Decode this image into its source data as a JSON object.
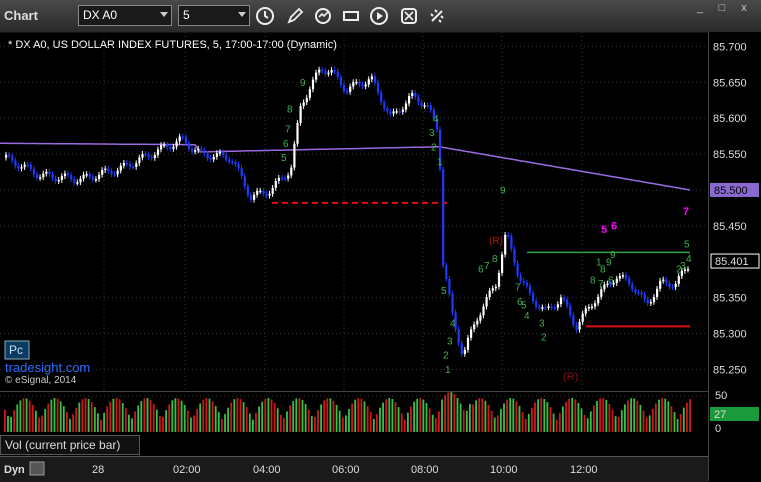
{
  "app": {
    "title": "Chart"
  },
  "toolbar": {
    "symbol": "DX A0",
    "interval": "5",
    "tools": [
      "clock-icon",
      "pencil-icon",
      "refresh-icon",
      "template-icon",
      "play-icon",
      "settings-icon",
      "link-icon"
    ]
  },
  "window": {
    "minimize": "_",
    "maximize": "□",
    "close": "x"
  },
  "chart": {
    "header": "* DX A0, US DOLLAR INDEX FUTURES, 5, 17:00-17:00 (Dynamic)",
    "watermark": "tradesight.com",
    "copyright": "© eSignal, 2014",
    "pc_label": "Pc",
    "colors": {
      "up": "#ffffff",
      "down": "#1f3aff",
      "ma": "#9a6be0",
      "red_line": "#e01010",
      "green_line": "#3ca03c",
      "green_text": "#3cb44b",
      "magenta_text": "#ff00ff"
    }
  },
  "chart_data": {
    "type": "candlestick",
    "y_ticks": [
      "85.700",
      "85.650",
      "85.600",
      "85.550",
      "85.500",
      "85.450",
      "85.401",
      "85.350",
      "85.300",
      "85.250"
    ],
    "ylim": [
      85.22,
      85.72
    ],
    "x_ticks": [
      "28",
      "02:00",
      "04:00",
      "06:00",
      "08:00",
      "10:00",
      "12:00"
    ],
    "last_price": "85.401",
    "ma_label": "85.500",
    "annotations_green": [
      "9",
      "8",
      "7",
      "6",
      "5",
      "4",
      "3",
      "2",
      "1",
      "9",
      "8",
      "7",
      "6",
      "5",
      "4",
      "3",
      "2",
      "1",
      "7",
      "6",
      "5",
      "4",
      "3",
      "2",
      "1",
      "8",
      "9",
      "9",
      "8",
      "7",
      "6",
      "5",
      "4",
      "3",
      "2",
      "1",
      "5"
    ],
    "annotations_magenta": [
      "5",
      "6",
      "7"
    ],
    "annotations_red": [
      "(R)",
      "(R)"
    ]
  },
  "volume": {
    "label": "Vol (current price bar)",
    "axis": [
      "50",
      "27",
      "0"
    ],
    "current": "27",
    "close": "×"
  },
  "status": {
    "dyn": "Dyn"
  }
}
